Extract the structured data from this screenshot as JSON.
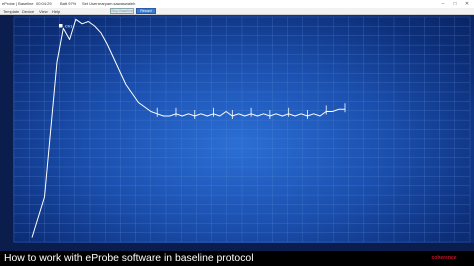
{
  "window": {
    "title": "eProbe | Baseline",
    "elapsed": "00:04:29",
    "battery": "Batt 97%",
    "set_user_label": "Set User:",
    "user": "maryam.sawaswaleh",
    "controls": {
      "minimize": "–",
      "maximize": "□",
      "close": "✕"
    }
  },
  "menu": {
    "items": [
      "Template",
      "Device",
      "View",
      "Help"
    ],
    "stop_button": "Stop Baseline",
    "record_button": "Record"
  },
  "plot": {
    "legend_label": "Ch1",
    "colors": {
      "trace": "#ffffff",
      "grid": "#5f8fd6",
      "background": "#1b4fae",
      "record_button": "#3a7bd5"
    }
  },
  "chart_data": {
    "type": "line",
    "series": [
      {
        "name": "Ch1",
        "x": [
          0,
          2,
          4,
          5,
          6,
          7,
          8,
          9,
          10,
          11,
          12,
          13,
          14,
          15,
          16,
          17,
          18,
          19,
          20,
          21,
          22,
          23,
          24,
          25,
          26,
          27,
          28,
          29,
          30,
          31,
          32,
          33,
          34,
          35,
          36,
          37,
          38,
          39,
          40,
          41,
          42,
          43,
          44,
          45,
          46,
          47,
          48,
          49,
          50
        ],
        "y": [
          2,
          20,
          80,
          95,
          90,
          99,
          97,
          98,
          96,
          93,
          88,
          82,
          76,
          70,
          66,
          62,
          60,
          58,
          57,
          56,
          56,
          57,
          56,
          57,
          56,
          57,
          56,
          57,
          56,
          58,
          56,
          57,
          56,
          57,
          56,
          57,
          56,
          57,
          56,
          57,
          56,
          57,
          56,
          57,
          56,
          58,
          58,
          59,
          59
        ]
      }
    ],
    "annotations": [
      "Ch1"
    ]
  },
  "caption": "How to work with eProbe software in baseline protocol",
  "logo_text": "coherence"
}
